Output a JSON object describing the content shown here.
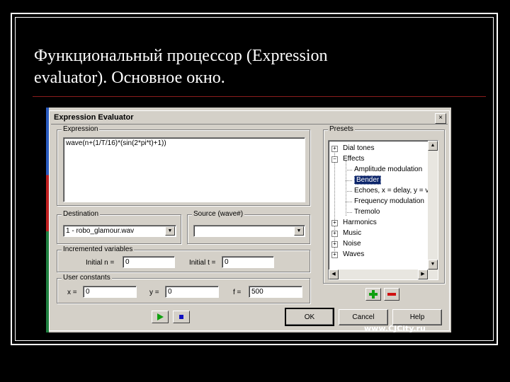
{
  "slide": {
    "title_line1": "Функциональный процессор (Expression",
    "title_line2": "evaluator). Основное окно."
  },
  "dialog": {
    "title": "Expression Evaluator",
    "close_glyph": "×",
    "expression": {
      "label": "Expression",
      "value": "wave(n+(1/T/16)*(sin(2*pi*t)+1))"
    },
    "destination": {
      "label": "Destination",
      "value": "1 - robo_glamour.wav"
    },
    "source": {
      "label": "Source (wave#)",
      "value": ""
    },
    "incremented": {
      "label": "Incremented variables",
      "n_label": "Initial n =",
      "n_value": "0",
      "t_label": "Initial t =",
      "t_value": "0"
    },
    "constants": {
      "label": "User constants",
      "x_label": "x =",
      "x_value": "0",
      "y_label": "y =",
      "y_value": "0",
      "f_label": "f =",
      "f_value": "500"
    },
    "presets": {
      "label": "Presets",
      "items": [
        {
          "label": "Dial tones",
          "expander": "+"
        },
        {
          "label": "Effects",
          "expander": "−"
        },
        {
          "label": "Amplitude modulation"
        },
        {
          "label": "Bender",
          "selected": true
        },
        {
          "label": "Echoes, x = delay, y = vol"
        },
        {
          "label": "Frequency modulation"
        },
        {
          "label": "Tremolo"
        },
        {
          "label": "Harmonics",
          "expander": "+"
        },
        {
          "label": "Music",
          "expander": "+"
        },
        {
          "label": "Noise",
          "expander": "+"
        },
        {
          "label": "Waves",
          "expander": "+"
        }
      ]
    },
    "buttons": {
      "ok": "OK",
      "cancel": "Cancel",
      "help": "Help"
    },
    "colors": {
      "play": "#10a010",
      "stop": "#1010c0",
      "add": "#10a010",
      "remove": "#d01010",
      "selection": "#0a246a"
    }
  },
  "watermark": "www.CJCity.ru"
}
